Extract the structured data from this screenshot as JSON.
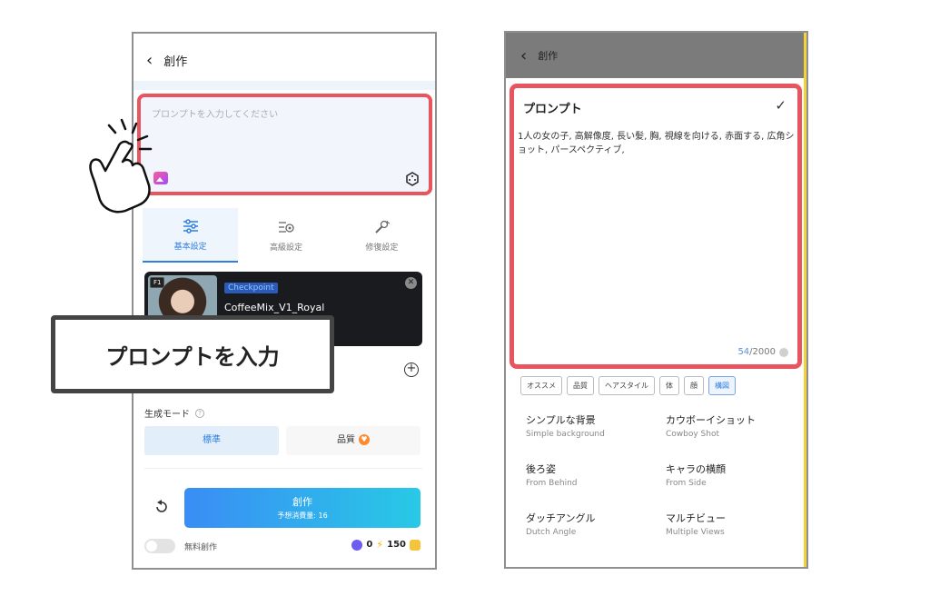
{
  "left": {
    "header_title": "創作",
    "prompt_placeholder": "プロンプトを入力してください",
    "tabs": [
      {
        "label": "基本設定",
        "icon": "sliders-icon",
        "active": true
      },
      {
        "label": "高級設定",
        "icon": "settings-gear-icon",
        "active": false
      },
      {
        "label": "修復設定",
        "icon": "wrench-icon",
        "active": false
      }
    ],
    "checkpoint": {
      "badge": "F1",
      "tag": "Checkpoint",
      "name": "CoffeeMix_V1_Royal"
    },
    "generation_mode_label": "生成モード",
    "modes": {
      "standard": "標準",
      "quality": "品質"
    },
    "create_button": {
      "label": "創作",
      "sub": "予想消費量: 16"
    },
    "free_creation_label": "無料創作",
    "balance": {
      "coins": "0",
      "energy": "150"
    }
  },
  "callout_text": "プロンプトを入力",
  "right": {
    "header_title": "創作",
    "prompt_title": "プロンプト",
    "prompt_text": "1人の女の子, 高解像度, 長い髪, 胸, 視線を向ける, 赤面する, 広角ショット, パースペクティブ,",
    "counter_current": "54",
    "counter_max": "/2000",
    "chips": [
      {
        "label": "オススメ",
        "active": false
      },
      {
        "label": "品質",
        "active": false
      },
      {
        "label": "ヘアスタイル",
        "active": false
      },
      {
        "label": "体",
        "active": false
      },
      {
        "label": "顔",
        "active": false
      },
      {
        "label": "構図",
        "active": true
      }
    ],
    "suggestions": [
      {
        "ja": "シンプルな背景",
        "en": "Simple background"
      },
      {
        "ja": "カウボーイショット",
        "en": "Cowboy Shot"
      },
      {
        "ja": "後ろ姿",
        "en": "From Behind"
      },
      {
        "ja": "キャラの横顔",
        "en": "From Side"
      },
      {
        "ja": "ダッチアングル",
        "en": "Dutch Angle"
      },
      {
        "ja": "マルチビュー",
        "en": "Multiple Views"
      }
    ]
  },
  "colors": {
    "accent": "#2f7fe0",
    "highlight": "#e8555f",
    "gradient_start": "#3a8df5",
    "gradient_end": "#28c9e6"
  }
}
